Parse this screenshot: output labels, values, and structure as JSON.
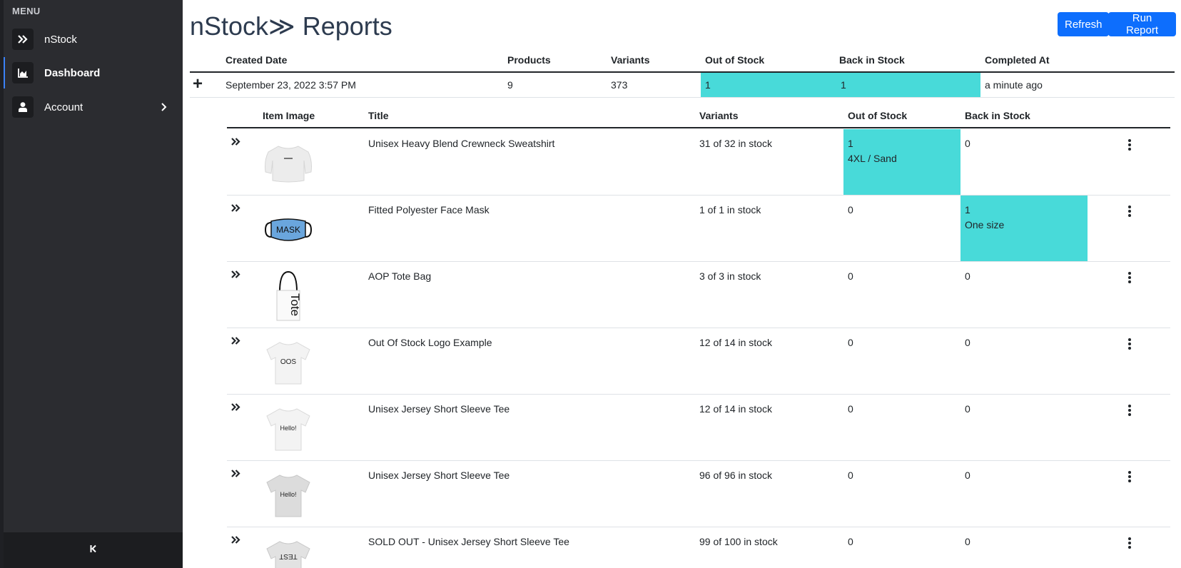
{
  "sidebar": {
    "menu_label": "MENU",
    "items": [
      {
        "label": "nStock",
        "icon": "double-chevron-right-icon"
      },
      {
        "label": "Dashboard",
        "icon": "bar-chart-icon",
        "active": true
      },
      {
        "label": "Account",
        "icon": "user-icon"
      }
    ],
    "collapse_icon": "collapse-left-icon"
  },
  "header": {
    "title": "nStock≫ Reports",
    "refresh_label": "Refresh",
    "run_report_label": "Run Report"
  },
  "colors": {
    "accent": "#0d6efd",
    "highlight": "#48dad9",
    "sidebar_bg": "#2b2c30"
  },
  "report_table": {
    "columns": [
      "Created Date",
      "Products",
      "Variants",
      "Out of Stock",
      "Back in Stock",
      "Completed At"
    ],
    "row": {
      "expand_symbol": "+",
      "created_date": "September 23, 2022 3:57 PM",
      "products": "9",
      "variants": "373",
      "out_of_stock": "1",
      "back_in_stock": "1",
      "completed_at": "a minute ago"
    }
  },
  "items_table": {
    "columns": [
      "Item Image",
      "Title",
      "Variants",
      "Out of Stock",
      "Back in Stock"
    ],
    "rows": [
      {
        "image": "sweatshirt",
        "title": "Unisex Heavy Blend Crewneck Sweatshirt",
        "variants": "31 of 32 in stock",
        "out_of_stock": "1",
        "out_of_stock_detail": "4XL / Sand",
        "back_in_stock": "0",
        "back_in_stock_detail": ""
      },
      {
        "image": "face-mask",
        "image_text": "MASK",
        "title": "Fitted Polyester Face Mask",
        "variants": "1 of 1 in stock",
        "out_of_stock": "0",
        "out_of_stock_detail": "",
        "back_in_stock": "1",
        "back_in_stock_detail": "One size"
      },
      {
        "image": "tote-bag",
        "image_text": "Tote",
        "title": "AOP Tote Bag",
        "variants": "3 of 3 in stock",
        "out_of_stock": "0",
        "out_of_stock_detail": "",
        "back_in_stock": "0",
        "back_in_stock_detail": ""
      },
      {
        "image": "tshirt",
        "image_text": "OOS",
        "title": "Out Of Stock Logo Example",
        "variants": "12 of 14 in stock",
        "out_of_stock": "0",
        "out_of_stock_detail": "",
        "back_in_stock": "0",
        "back_in_stock_detail": ""
      },
      {
        "image": "tshirt",
        "image_text": "Hello!",
        "title": "Unisex Jersey Short Sleeve Tee",
        "variants": "12 of 14 in stock",
        "out_of_stock": "0",
        "out_of_stock_detail": "",
        "back_in_stock": "0",
        "back_in_stock_detail": ""
      },
      {
        "image": "tshirt-grey",
        "image_text": "Hello!",
        "title": "Unisex Jersey Short Sleeve Tee",
        "variants": "96 of 96 in stock",
        "out_of_stock": "0",
        "out_of_stock_detail": "",
        "back_in_stock": "0",
        "back_in_stock_detail": ""
      },
      {
        "image": "tshirt-grey",
        "image_text": "TEST",
        "title": "SOLD OUT - Unisex Jersey Short Sleeve Tee",
        "variants": "99 of 100 in stock",
        "out_of_stock": "0",
        "out_of_stock_detail": "",
        "back_in_stock": "0",
        "back_in_stock_detail": ""
      }
    ]
  }
}
